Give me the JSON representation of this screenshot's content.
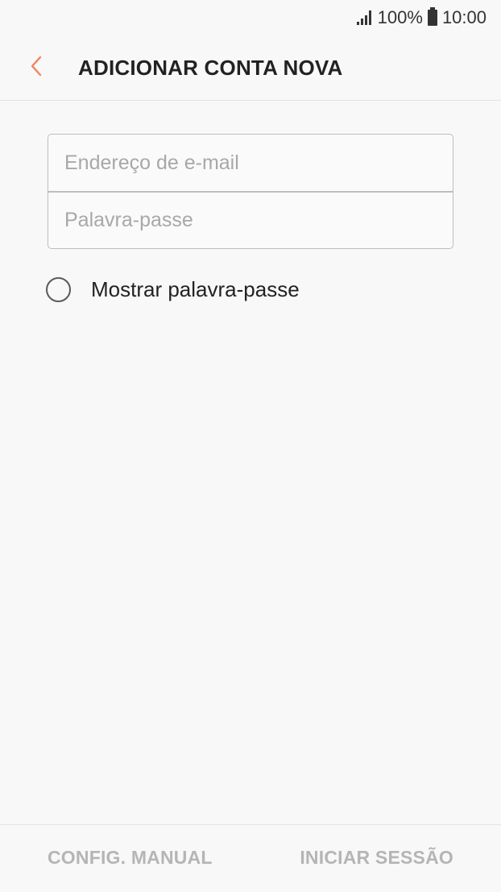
{
  "status_bar": {
    "battery_percent": "100%",
    "time": "10:00",
    "signal_icon": "signal-icon",
    "battery_icon": "battery-icon"
  },
  "app_bar": {
    "back_icon": "chevron-left-icon",
    "title": "ADICIONAR CONTA NOVA",
    "accent_color": "#f0845a"
  },
  "form": {
    "email_placeholder": "Endereço de e-mail",
    "email_value": "",
    "password_placeholder": "Palavra-passe",
    "password_value": ""
  },
  "show_password": {
    "label": "Mostrar palavra-passe",
    "checked": false
  },
  "bottom_bar": {
    "manual_label": "CONFIG. MANUAL",
    "login_label": "INICIAR SESSÃO",
    "disabled_color": "#b5b5b5"
  }
}
